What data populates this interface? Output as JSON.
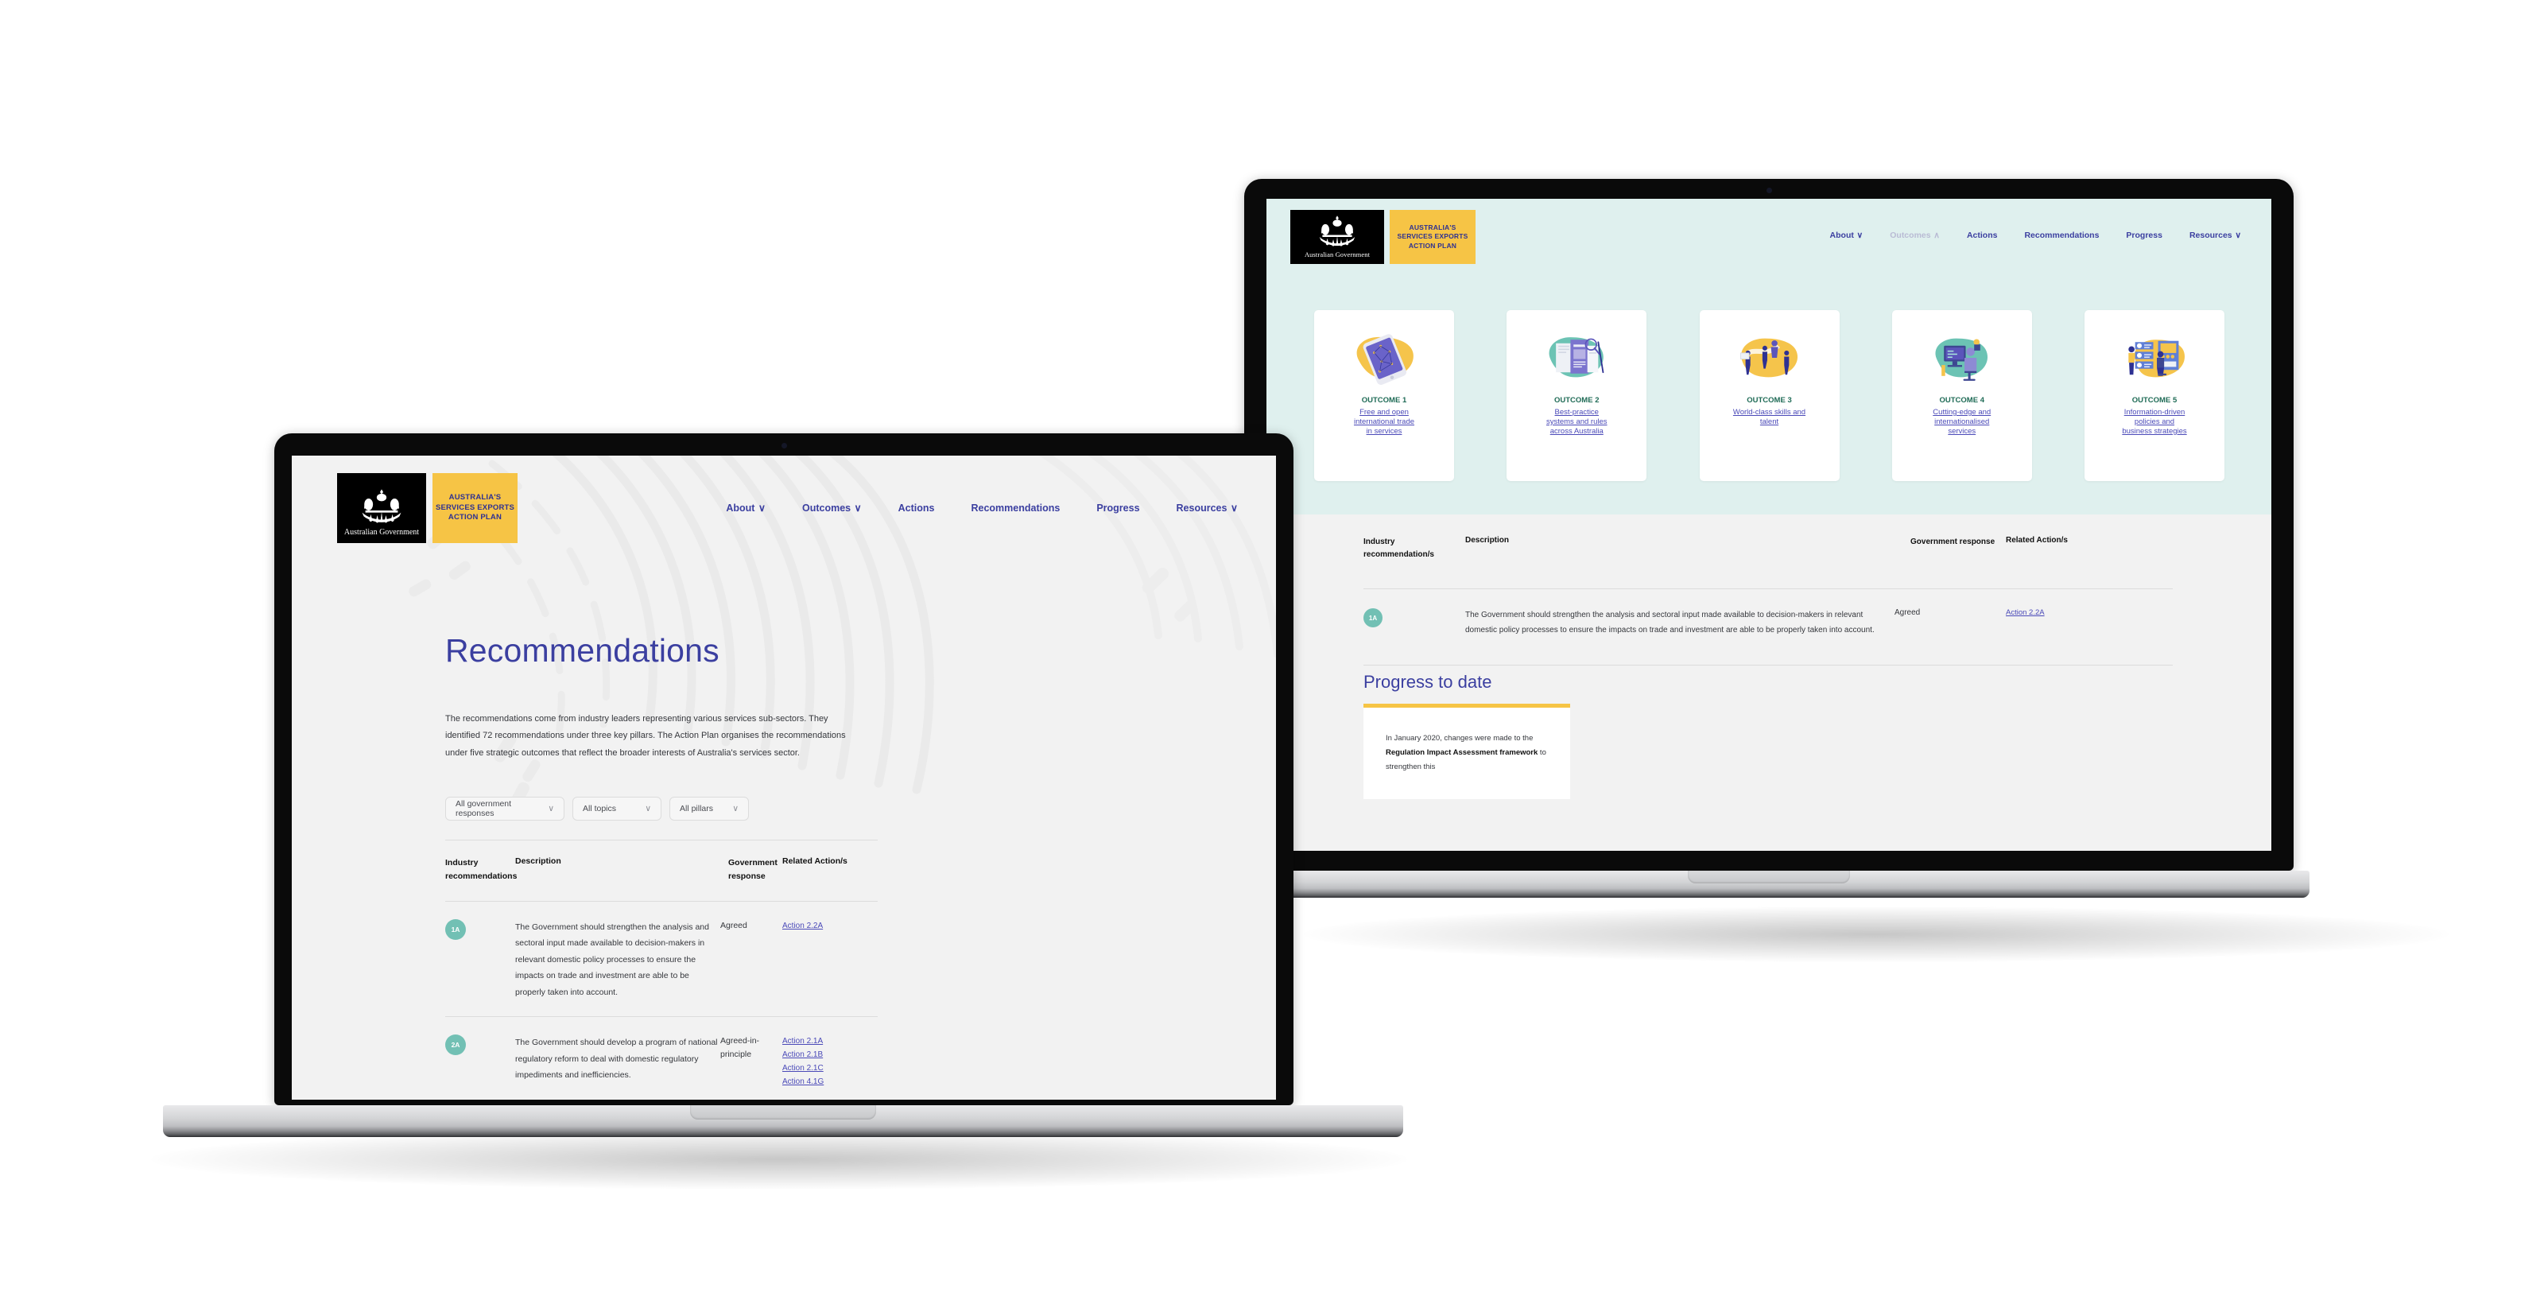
{
  "brand": {
    "gov_text": "Australian Government",
    "line1": "AUSTRALIA'S",
    "line2": "SERVICES EXPORTS",
    "line3": "ACTION PLAN"
  },
  "nav": {
    "items": [
      {
        "label": "About",
        "chevron": "∨"
      },
      {
        "label": "Outcomes",
        "chevron": "∨"
      },
      {
        "label": "Actions",
        "chevron": ""
      },
      {
        "label": "Recommendations",
        "chevron": ""
      },
      {
        "label": "Progress",
        "chevron": ""
      },
      {
        "label": "Resources",
        "chevron": "∨"
      }
    ],
    "items_right": [
      {
        "label": "About",
        "chevron": "∨"
      },
      {
        "label": "Outcomes",
        "chevron": "∧"
      },
      {
        "label": "Actions",
        "chevron": ""
      },
      {
        "label": "Recommendations",
        "chevron": ""
      },
      {
        "label": "Progress",
        "chevron": ""
      },
      {
        "label": "Resources",
        "chevron": "∨"
      }
    ]
  },
  "laptop_left": {
    "page_title": "Recommendations",
    "intro": "The recommendations come from industry leaders representing various services sub-sectors. They identified 72 recommendations under three key pillars. The Action Plan organises the recommendations under five strategic outcomes that reflect the broader interests of Australia's services sector.",
    "filters": [
      {
        "value": "All government responses",
        "arrow": "∨"
      },
      {
        "value": "All topics",
        "arrow": "∨"
      },
      {
        "value": "All pillars",
        "arrow": "∨"
      }
    ],
    "table": {
      "headers": {
        "col1": "Industry recommendations",
        "col2": "Description",
        "col3": "Government response",
        "col4": "Related Action/s"
      },
      "rows": [
        {
          "badge": "1A",
          "description": "The Government should strengthen the analysis and sectoral input made available to decision-makers in relevant domestic policy processes to ensure the impacts on trade and investment are able to be properly taken into account.",
          "response": "Agreed",
          "actions": [
            "Action 2.2A"
          ]
        },
        {
          "badge": "2A",
          "description": "The Government should develop a program of national regulatory reform to deal with domestic regulatory impediments and inefficiencies.",
          "response": "Agreed-in-principle",
          "actions": [
            "Action 2.1A",
            "Action 2.1B",
            "Action 2.1C",
            "Action 4.1G"
          ]
        }
      ]
    }
  },
  "laptop_right": {
    "outcome_cards": [
      {
        "caption": "OUTCOME 1",
        "link": "Free and open international trade in services",
        "icon": "phone-network-illustration"
      },
      {
        "caption": "OUTCOME 2",
        "link": "Best-practice systems and rules across Australia",
        "icon": "documents-magnifier-illustration"
      },
      {
        "caption": "OUTCOME 3",
        "link": "World-class skills and talent",
        "icon": "people-growth-chart-illustration"
      },
      {
        "caption": "OUTCOME 4",
        "link": "Cutting-edge and internationalised services",
        "icon": "person-computer-illustration"
      },
      {
        "caption": "OUTCOME 5",
        "link": "Information-driven policies and business strategies",
        "icon": "dashboard-people-illustration"
      }
    ],
    "table": {
      "headers": {
        "col1": "Industry recommendation/s",
        "col2": "Description",
        "col3": "Government response",
        "col4": "Related Action/s"
      },
      "rows": [
        {
          "badge": "1A",
          "description": "The Government should strengthen the analysis and sectoral input made available to decision-makers in relevant domestic policy processes to ensure the impacts on trade and investment are able to be properly taken into account.",
          "response": "Agreed",
          "actions": [
            "Action 2.2A"
          ]
        }
      ]
    },
    "progress": {
      "title": "Progress to date",
      "text_part1": "In January 2020, changes were made to the ",
      "text_bold": "Regulation Impact Assessment framework",
      "text_part2": " to strengthen this"
    }
  },
  "colors": {
    "brand_yellow": "#f6c445",
    "brand_indigo": "#3b3fa0",
    "link_violet": "#4a49b8",
    "badge_teal": "#72c0b4",
    "hero_mint": "#dff0ee",
    "page_grey": "#f2f2f2",
    "outcome_green": "#1f6b56"
  }
}
